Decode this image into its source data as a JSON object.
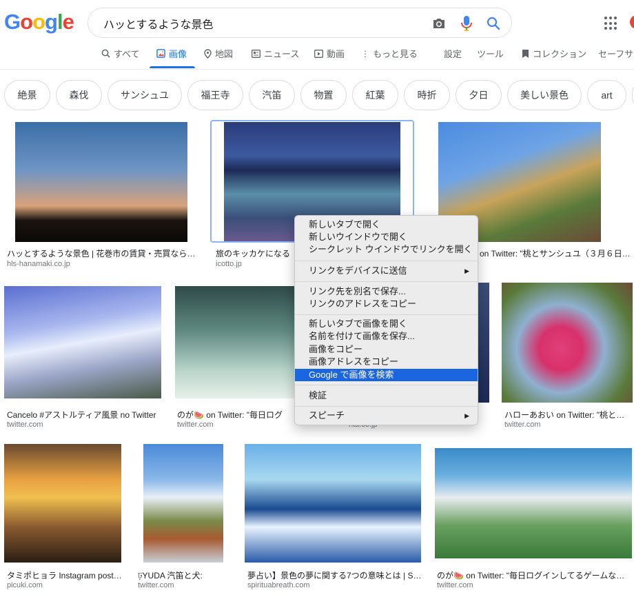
{
  "header": {
    "logo_letters": [
      {
        "ch": "G",
        "color": "#4285F4"
      },
      {
        "ch": "o",
        "color": "#EA4335"
      },
      {
        "ch": "o",
        "color": "#FBBC05"
      },
      {
        "ch": "g",
        "color": "#4285F4"
      },
      {
        "ch": "l",
        "color": "#34A853"
      },
      {
        "ch": "e",
        "color": "#EA4335"
      }
    ],
    "query": "ハッとするような景色",
    "icons": {
      "camera": "camera-icon",
      "mic": "microphone-icon",
      "search": "search-icon",
      "apps": "apps-grid-icon"
    }
  },
  "tabs": [
    {
      "label": "すべて",
      "icon": "search-icon",
      "active": false
    },
    {
      "label": "画像",
      "icon": "image-icon",
      "active": true
    },
    {
      "label": "地図",
      "icon": "map-pin-icon",
      "active": false
    },
    {
      "label": "ニュース",
      "icon": "news-icon",
      "active": false
    },
    {
      "label": "動画",
      "icon": "video-icon",
      "active": false
    },
    {
      "label": "もっと見る",
      "icon": "more-vert-icon",
      "active": false
    }
  ],
  "tools": {
    "settings": "設定",
    "tools": "ツール",
    "collections": "コレクション",
    "safesearch": "セーフサー"
  },
  "chips": [
    "絶景",
    "森伐",
    "サンシュユ",
    "福王寺",
    "汽笛",
    "物置",
    "紅葉",
    "時折",
    "夕日",
    "美しい景色",
    "art"
  ],
  "results": {
    "row1": [
      {
        "title": "ハッとするような景色 | 花巻市の賃貸・売買ならホ…",
        "source": "hls-hanamaki.co.jp"
      },
      {
        "title": "旅のキッカケになる",
        "source": "icotto.jp"
      },
      {
        "title": "on Twitter: \"桃とサンシュユ（３月６日…",
        "source": ""
      }
    ],
    "row2": [
      {
        "title": "Cancelo #アストルティア風景 no Twitter",
        "source": "twitter.com"
      },
      {
        "title": "のが🍉 on Twitter: \"毎日ログ",
        "source": "twitter.com"
      },
      {
        "title": "",
        "source": "nta.co.jp"
      },
      {
        "title": "ハローあおい on Twitter: \"桃とサ…",
        "source": "twitter.com"
      }
    ],
    "row3": [
      {
        "title": "タミポヒョラ Instagram post…",
        "source": "picuki.com"
      },
      {
        "title": "ঢ়YUDA 汽笛と犬:",
        "source": "twitter.com"
      },
      {
        "title": "夢占い】景色の夢に関する7つの意味とは | S…",
        "source": "spirituabreath.com"
      },
      {
        "title": "のが🍉 on Twitter: \"毎日ログインしてるゲームな…",
        "source": "twitter.com"
      }
    ]
  },
  "context_menu": {
    "g1": [
      "新しいタブで開く",
      "新しいウインドウで開く",
      "シークレット ウインドウでリンクを開く"
    ],
    "g2": [
      "リンクをデバイスに送信"
    ],
    "g3": [
      "リンク先を別名で保存...",
      "リンクのアドレスをコピー"
    ],
    "g4": [
      "新しいタブで画像を開く",
      "名前を付けて画像を保存...",
      "画像をコピー",
      "画像アドレスをコピー",
      "Google で画像を検索"
    ],
    "g5": [
      "検証"
    ],
    "g6": [
      "スピーチ"
    ],
    "submenu_arrow": "▶"
  }
}
